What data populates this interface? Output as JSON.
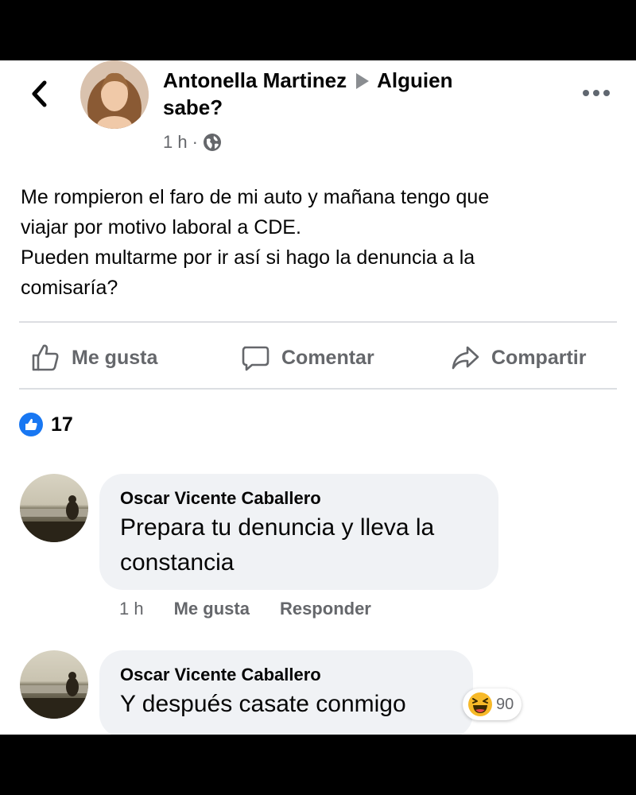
{
  "post": {
    "author": "Antonella Martinez",
    "group_line1": "Alguien",
    "group_line2": "sabe?",
    "time": "1 h",
    "dot": "·",
    "body": "Me rompieron el faro de mi auto y mañana tengo que\nviajar por motivo laboral a CDE.\nPueden multarme por ir así si hago la denuncia a la\ncomisaría?"
  },
  "actions": {
    "like": "Me gusta",
    "comment": "Comentar",
    "share": "Compartir"
  },
  "reactions": {
    "count": "17"
  },
  "comments": [
    {
      "author": "Oscar Vicente Caballero",
      "text_line1": "Prepara tu denuncia y lleva la",
      "text_line2": "constancia",
      "time": "1 h",
      "like": "Me gusta",
      "reply": "Responder"
    },
    {
      "author": "Oscar Vicente Caballero",
      "text": "Y después casate conmigo",
      "reaction_count": "90"
    }
  ],
  "icons": {
    "back": "chevron-left-icon",
    "more": "more-horizontal-icon",
    "privacy": "globe-icon",
    "like": "thumbs-up-icon",
    "comment": "speech-bubble-icon",
    "share": "share-arrow-icon",
    "haha": "laughing-emoji-icon"
  },
  "colors": {
    "accent": "#1877f2",
    "muted": "#65676b",
    "bubble": "#f0f2f5"
  }
}
